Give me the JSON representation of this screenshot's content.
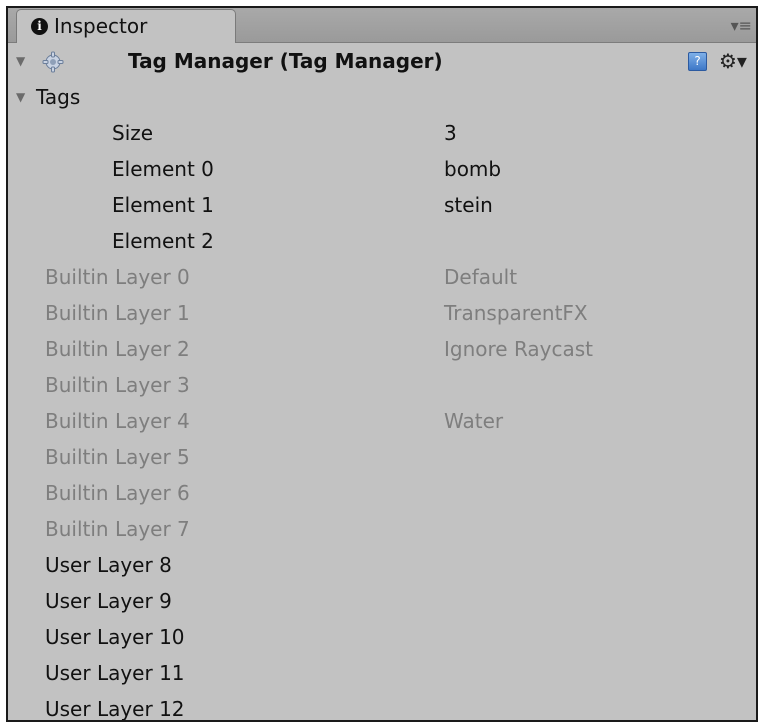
{
  "tab": {
    "title": "Inspector",
    "info_icon": "i"
  },
  "header": {
    "title": "Tag Manager (Tag Manager)",
    "help_icon": "?",
    "settings_icon": "⚙▾"
  },
  "menu_icon": "▾≡",
  "fold_glyph": "▼",
  "tags_section": {
    "label": "Tags",
    "rows": [
      {
        "label": "Size",
        "value": "3"
      },
      {
        "label": "Element 0",
        "value": "bomb"
      },
      {
        "label": "Element 1",
        "value": "stein"
      },
      {
        "label": "Element 2",
        "value": ""
      }
    ]
  },
  "builtin_layers": [
    {
      "label": "Builtin Layer 0",
      "value": "Default"
    },
    {
      "label": "Builtin Layer 1",
      "value": "TransparentFX"
    },
    {
      "label": "Builtin Layer 2",
      "value": "Ignore Raycast"
    },
    {
      "label": "Builtin Layer 3",
      "value": ""
    },
    {
      "label": "Builtin Layer 4",
      "value": "Water"
    },
    {
      "label": "Builtin Layer 5",
      "value": ""
    },
    {
      "label": "Builtin Layer 6",
      "value": ""
    },
    {
      "label": "Builtin Layer 7",
      "value": ""
    }
  ],
  "user_layers": [
    {
      "label": "User Layer 8",
      "value": ""
    },
    {
      "label": "User Layer 9",
      "value": ""
    },
    {
      "label": "User Layer 10",
      "value": ""
    },
    {
      "label": "User Layer 11",
      "value": ""
    },
    {
      "label": "User Layer 12",
      "value": ""
    }
  ],
  "colors": {
    "panel_background": "#c2c2c2",
    "disabled_text": "#7e7e7e",
    "text": "#111111"
  }
}
